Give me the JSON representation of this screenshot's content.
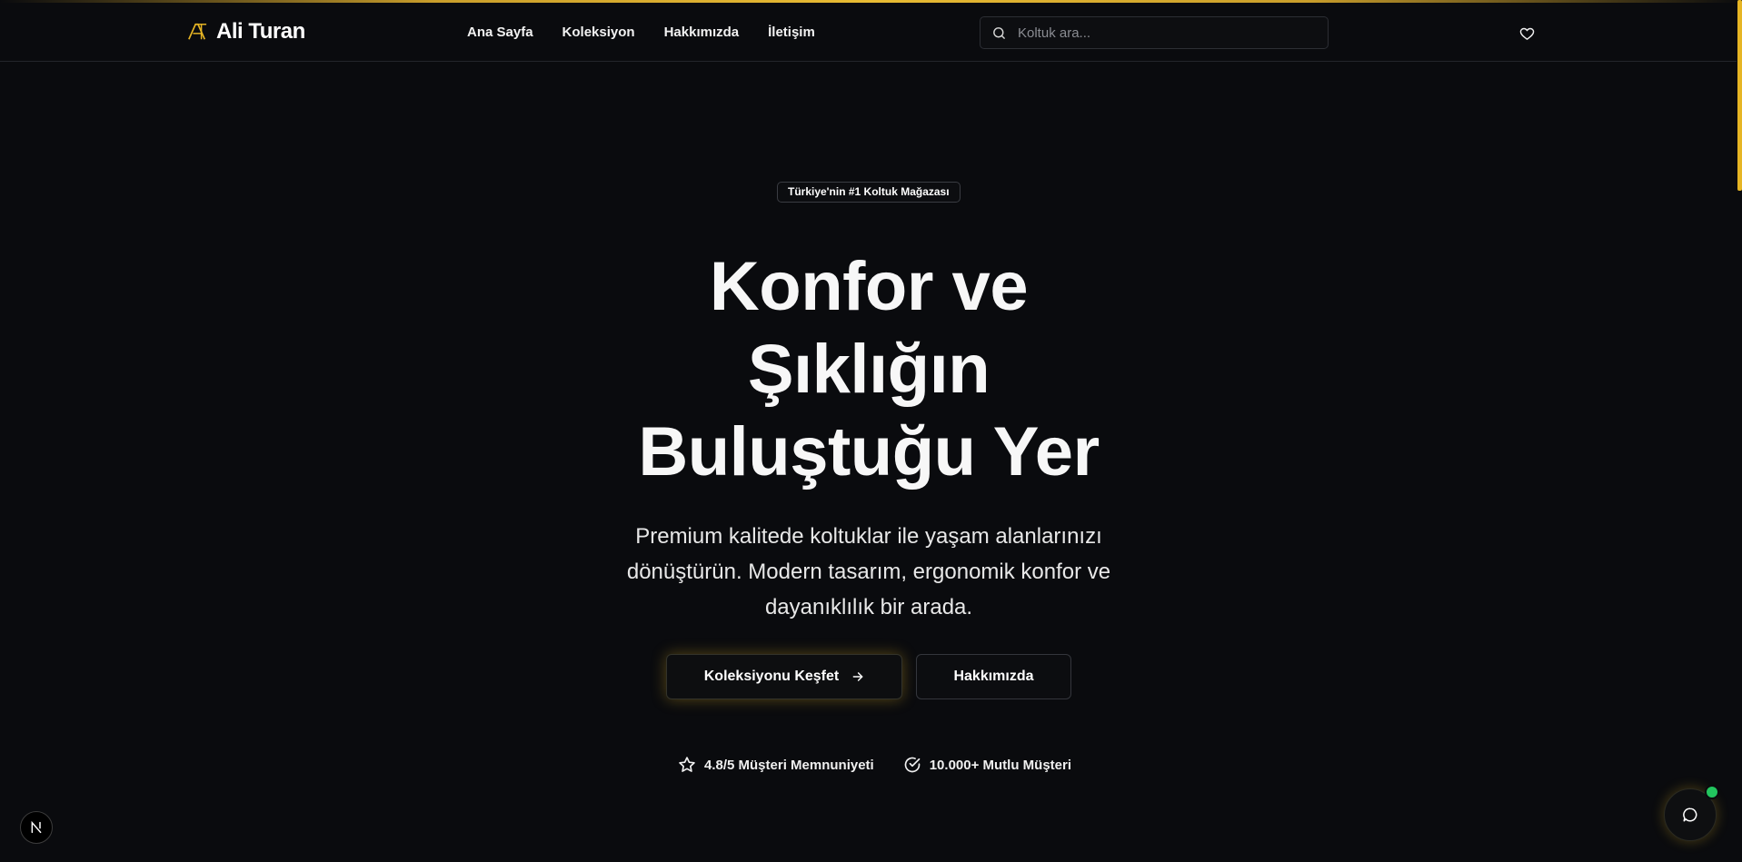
{
  "brand": {
    "name": "Ali Turan",
    "logo_icon": "initials-logo-icon",
    "accent": "#e6b524"
  },
  "nav": {
    "items": [
      "Ana Sayfa",
      "Koleksiyon",
      "Hakkımızda",
      "İletişim"
    ]
  },
  "search": {
    "placeholder": "Koltuk ara...",
    "value": "",
    "icon": "search-icon"
  },
  "header": {
    "favorites_icon": "heart-icon"
  },
  "hero": {
    "badge": "Türkiye'nin #1 Koltuk Mağazası",
    "title_lines": [
      "Konfor ve",
      "Şıklığın",
      "Buluştuğu Yer"
    ],
    "subtitle_lines": [
      "Premium kalitede koltuklar ile yaşam alanlarınızı",
      "dönüştürün. Modern tasarım, ergonomik konfor ve",
      "dayanıklılık bir arada."
    ],
    "primary_button": "Koleksiyonu Keşfet",
    "secondary_button": "Hakkımızda",
    "stats": [
      {
        "icon": "star-icon",
        "label": "4.8/5 Müşteri Memnuniyeti"
      },
      {
        "icon": "check-circle-icon",
        "label": "10.000+ Mutlu Müşteri"
      }
    ]
  },
  "widgets": {
    "dev_badge": "N",
    "chat_icon": "chat-bubble-icon",
    "online_color": "#22c55e"
  },
  "colors": {
    "background": "#0a0b0e",
    "text": "#f5f5f5",
    "accent": "#e6b524"
  }
}
